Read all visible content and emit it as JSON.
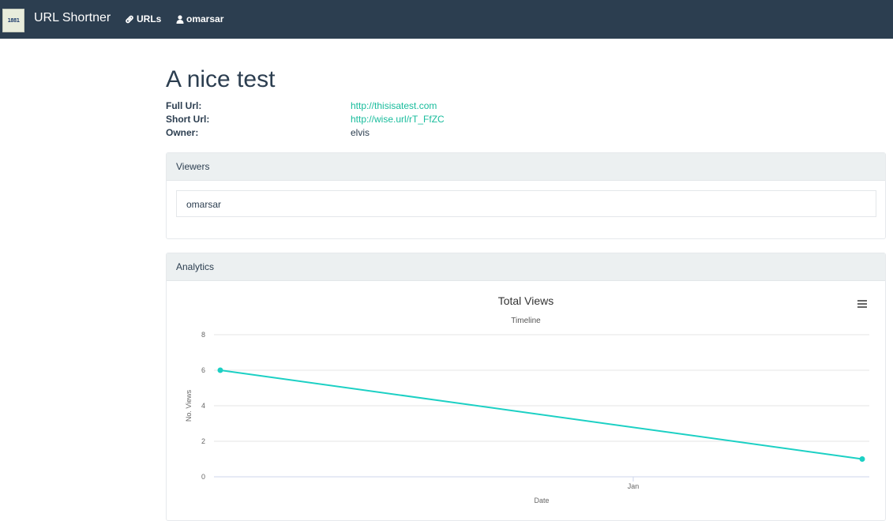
{
  "navbar": {
    "logo_text": "1881",
    "brand": "URL Shortner",
    "urls_label": "URLs",
    "user_label": "omarsar"
  },
  "page": {
    "title": "A nice test",
    "details": [
      {
        "label": "Full Url:",
        "value": "http://thisisatest.com"
      },
      {
        "label": "Short Url:",
        "value": "http://wise.url/rT_FfZC"
      },
      {
        "label": "Owner:",
        "value": "elvis"
      }
    ]
  },
  "viewers_panel": {
    "heading": "Viewers",
    "items": [
      "omarsar"
    ]
  },
  "analytics_panel": {
    "heading": "Analytics"
  },
  "colors": {
    "navbar": "#2c3e50",
    "link": "#18bc9c",
    "series": "#1cd0c4"
  },
  "chart_data": {
    "type": "line",
    "title": "Total Views",
    "subtitle": "Timeline",
    "xlabel": "Date",
    "ylabel": "No. Views",
    "x_tick_labels": [
      "Jan"
    ],
    "y_ticks": [
      0,
      2,
      4,
      6,
      8
    ],
    "ylim": [
      0,
      8
    ],
    "grid": true,
    "legend": "none",
    "series": [
      {
        "points": [
          6,
          1
        ]
      }
    ]
  }
}
